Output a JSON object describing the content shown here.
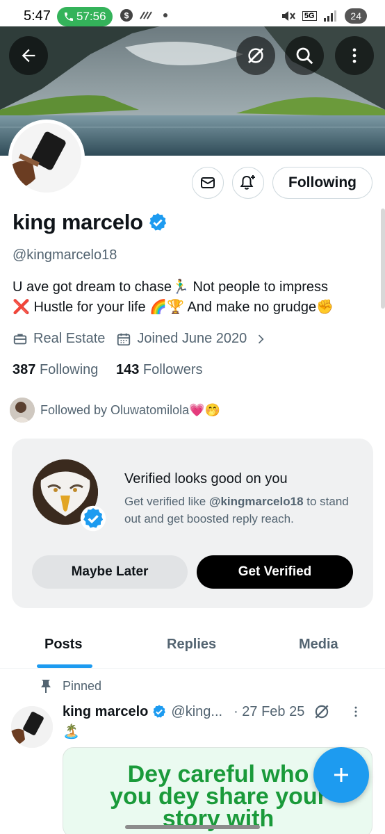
{
  "status_bar": {
    "time": "5:47",
    "call_timer": "57:56",
    "network": "5G",
    "battery": "24"
  },
  "header": {
    "back_icon": "arrow-left-icon",
    "grok_icon": "grok-icon",
    "search_icon": "search-icon",
    "more_icon": "more-vertical-icon"
  },
  "profile": {
    "name": "king marcelo",
    "handle": "@kingmarcelo18",
    "bio_line1": "U ave got dream to chase🏃‍♂️ Not people to impress",
    "bio_line2": "❌ Hustle for your life 🌈🏆 And make no grudge✊",
    "category": "Real Estate",
    "joined": "Joined June 2020",
    "following_count": "387",
    "following_label": "Following",
    "followers_count": "143",
    "followers_label": "Followers",
    "followed_by": "Followed by Oluwatomilola💗🤭",
    "following_button": "Following",
    "verified_color": "#1d9bf0"
  },
  "promo": {
    "title": "Verified looks good on you",
    "subtitle_prefix": "Get verified like ",
    "subtitle_handle": "@kingmarcelo18",
    "subtitle_suffix": " to stand out and get boosted reply reach.",
    "maybe_later": "Maybe Later",
    "get_verified": "Get Verified"
  },
  "tabs": [
    {
      "label": "Posts",
      "active": true
    },
    {
      "label": "Replies",
      "active": false
    },
    {
      "label": "Media",
      "active": false
    }
  ],
  "post": {
    "pinned_label": "Pinned",
    "name": "king marcelo",
    "handle": "@king...",
    "date": "· 27 Feb 25",
    "emoji": "🏝️",
    "image_text_line1": "Dey careful who",
    "image_text_line2": "you dey share your",
    "image_text_line3": "story with"
  },
  "colors": {
    "accent": "#1d9bf0",
    "text": "#0f1419",
    "muted": "#536471"
  }
}
